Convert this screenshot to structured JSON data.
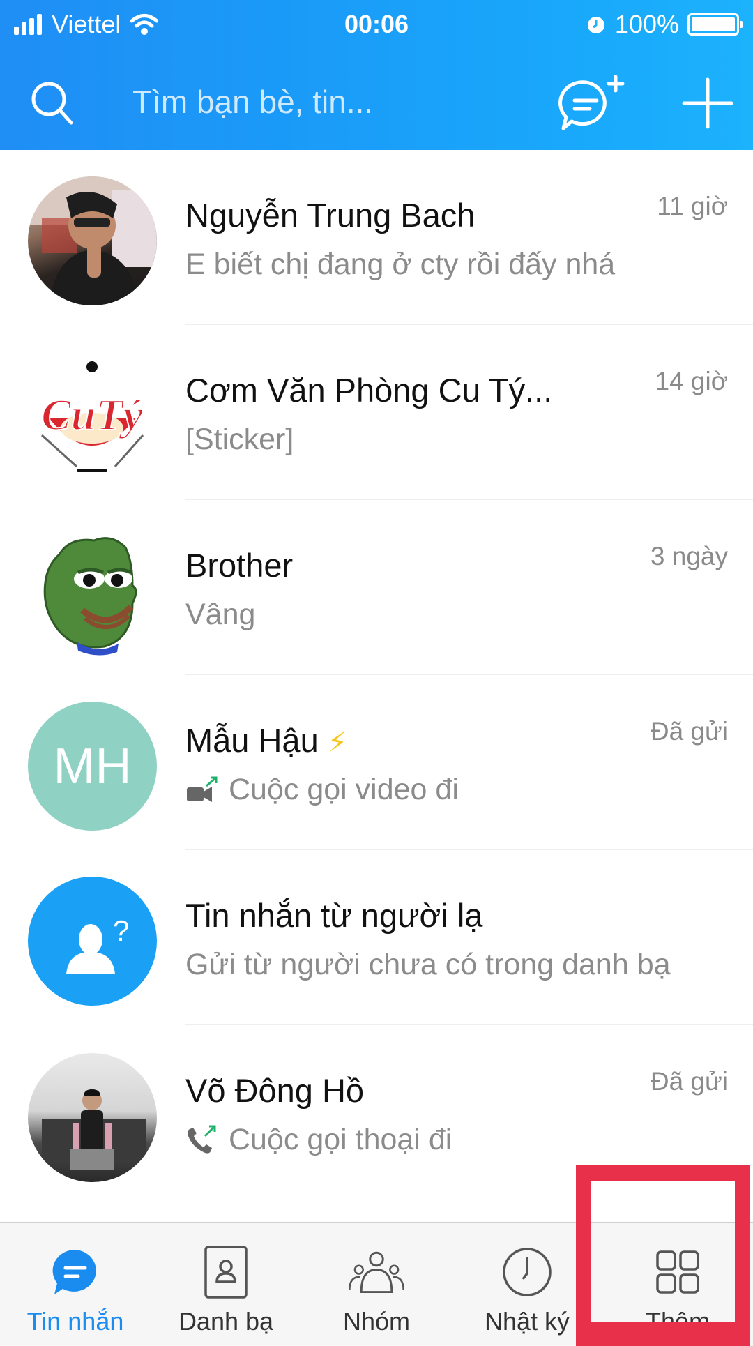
{
  "status_bar": {
    "carrier": "Viettel",
    "time": "00:06",
    "battery": "100%",
    "icons": [
      "signal-icon",
      "wifi-icon",
      "alarm-icon",
      "battery-icon"
    ]
  },
  "header": {
    "search_placeholder": "Tìm bạn bè, tin...",
    "search_icon": "search-icon",
    "new_chat_icon": "new-chat-icon",
    "add_icon": "plus-icon"
  },
  "colors": {
    "header_blue": "#1a9bf8",
    "accent": "#1a8cf0",
    "highlight": "#e9304a",
    "mh_avatar": "#8fd1c3",
    "stranger_avatar": "#1aa1f5"
  },
  "conversations": [
    {
      "name": "Nguyễn Trung Bach",
      "time": "11 giờ",
      "preview": "E biết chị đang ở cty rồi đấy nhá",
      "preview_icon": null,
      "avatar": "photo"
    },
    {
      "name": "Cơm Văn Phòng Cu Tý...",
      "time": "14 giờ",
      "preview": "[Sticker]",
      "preview_icon": null,
      "avatar": "cuty-logo",
      "avatar_text": "CuTý"
    },
    {
      "name": "Brother",
      "time": "3 ngày",
      "preview": "Vâng",
      "preview_icon": null,
      "avatar": "frog-sticker"
    },
    {
      "name": "Mẫu Hậu",
      "badge": "⚡",
      "time": "Đã gửi",
      "preview": "Cuộc gọi video đi",
      "preview_icon": "outgoing-video-call-icon",
      "avatar": "initials",
      "avatar_text": "MH"
    },
    {
      "name": "Tin nhắn từ người lạ",
      "time": "",
      "preview": "Gửi từ người chưa có trong danh bạ",
      "preview_icon": null,
      "avatar": "stranger-icon"
    },
    {
      "name": "Võ Đông Hồ",
      "time": "Đã gửi",
      "preview": "Cuộc gọi thoại đi",
      "preview_icon": "outgoing-voice-call-icon",
      "avatar": "photo"
    }
  ],
  "tabs": [
    {
      "label": "Tin nhắn",
      "icon": "chat-bubble-icon",
      "active": true
    },
    {
      "label": "Danh bạ",
      "icon": "contacts-icon",
      "active": false
    },
    {
      "label": "Nhóm",
      "icon": "group-icon",
      "active": false
    },
    {
      "label": "Nhật ký",
      "icon": "clock-icon",
      "active": false
    },
    {
      "label": "Thêm",
      "icon": "grid-icon",
      "active": false
    }
  ]
}
